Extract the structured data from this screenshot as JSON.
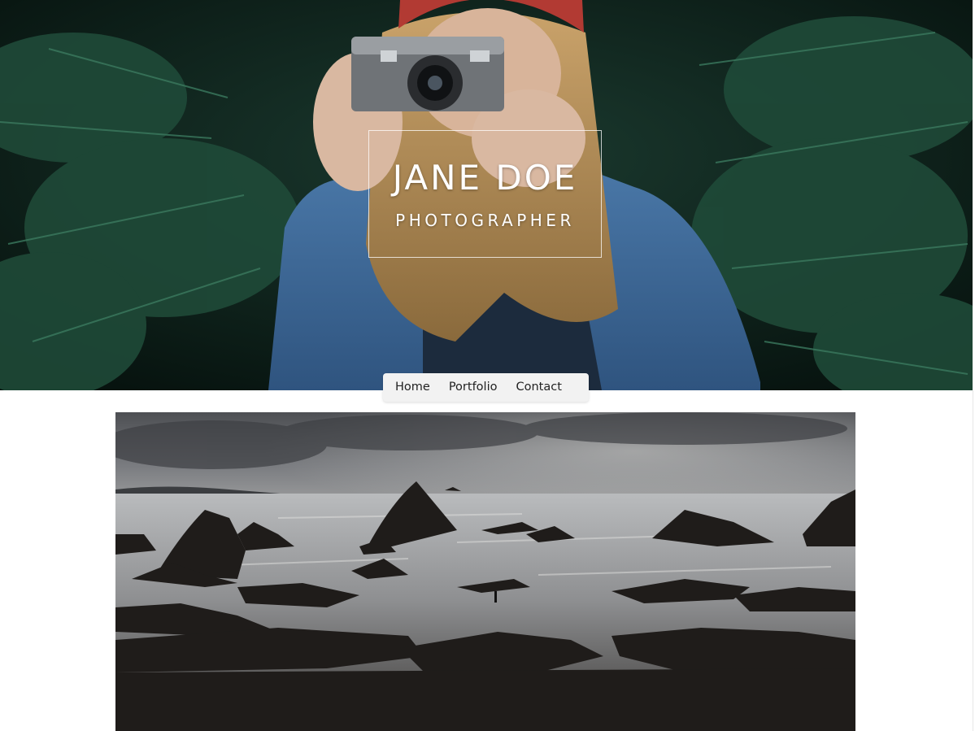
{
  "hero": {
    "name": "JANE DOE",
    "role": "PHOTOGRAPHER"
  },
  "nav": {
    "items": [
      {
        "label": "Home"
      },
      {
        "label": "Portfolio"
      },
      {
        "label": "Contact"
      }
    ]
  },
  "colors": {
    "hero_foliage": "#163126",
    "denim": "#3d6a9a",
    "hat": "#b23a33",
    "nav_bg": "#f2f2f2",
    "sky": "#6e7074",
    "rock": "#1f1c1a"
  },
  "images": {
    "hero": "photographer-with-camera-photo",
    "content": "rocky-coastline-photo"
  }
}
